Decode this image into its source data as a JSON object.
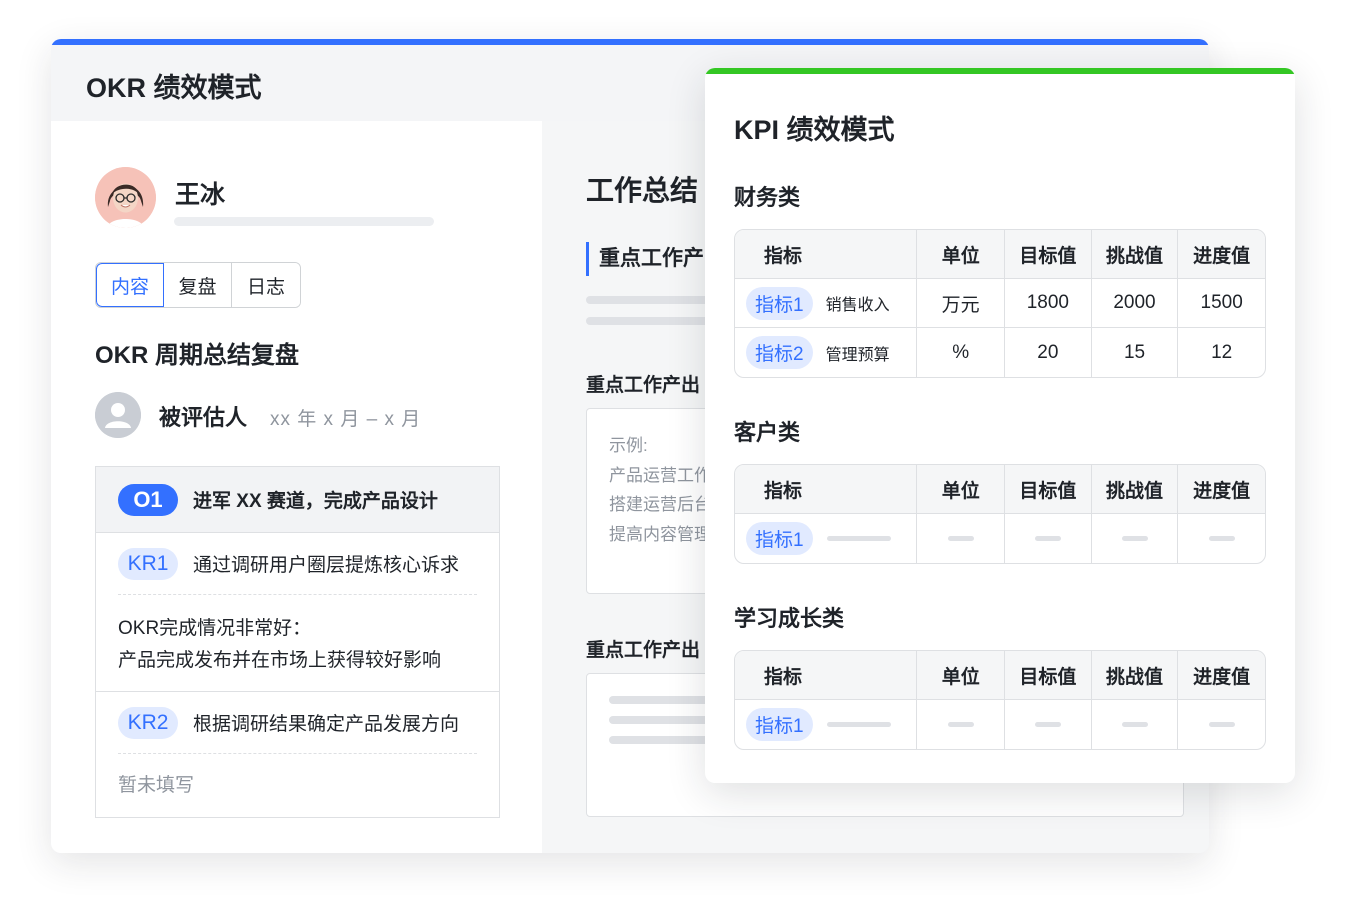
{
  "okr": {
    "title": "OKR 绩效模式",
    "user_name": "王冰",
    "tabs": [
      "内容",
      "复盘",
      "日志"
    ],
    "section_title": "OKR 周期总结复盘",
    "reviewee_label": "被评估人",
    "reviewee_period": "xx 年 x 月 – x 月",
    "objective": {
      "badge": "O1",
      "text": "进军 XX 赛道，完成产品设计"
    },
    "key_results": [
      {
        "badge": "KR1",
        "text": "通过调研用户圈层提炼核心诉求",
        "body": [
          "OKR完成情况非常好：",
          "产品完成发布并在市场上获得较好影响"
        ],
        "empty": false
      },
      {
        "badge": "KR2",
        "text": "根据调研结果确定产品发展方向",
        "body": [
          "暂未填写"
        ],
        "empty": true
      }
    ],
    "work_title": "工作总结",
    "focus_head": "重点工作产",
    "sub_title_1": "重点工作产出",
    "example_lines": [
      "示例:",
      "产品运营工作",
      "搭建运营后台",
      "提高内容管理"
    ],
    "sub_title_2": "重点工作产出"
  },
  "kpi": {
    "title": "KPI 绩效模式",
    "headers": [
      "指标",
      "单位",
      "目标值",
      "挑战值",
      "进度值"
    ],
    "categories": [
      {
        "title": "财务类",
        "rows": [
          {
            "badge": "指标1",
            "name": "销售收入",
            "unit": "万元",
            "target": "1800",
            "challenge": "2000",
            "progress": "1500"
          },
          {
            "badge": "指标2",
            "name": "管理预算",
            "unit": "%",
            "target": "20",
            "challenge": "15",
            "progress": "12"
          }
        ]
      },
      {
        "title": "客户类",
        "rows": [
          {
            "badge": "指标1"
          }
        ]
      },
      {
        "title": "学习成长类",
        "rows": [
          {
            "badge": "指标1"
          }
        ]
      }
    ]
  },
  "colors": {
    "okr_accent": "#3370ff",
    "kpi_accent": "#34c724",
    "badge_bg": "#e1eaff"
  }
}
